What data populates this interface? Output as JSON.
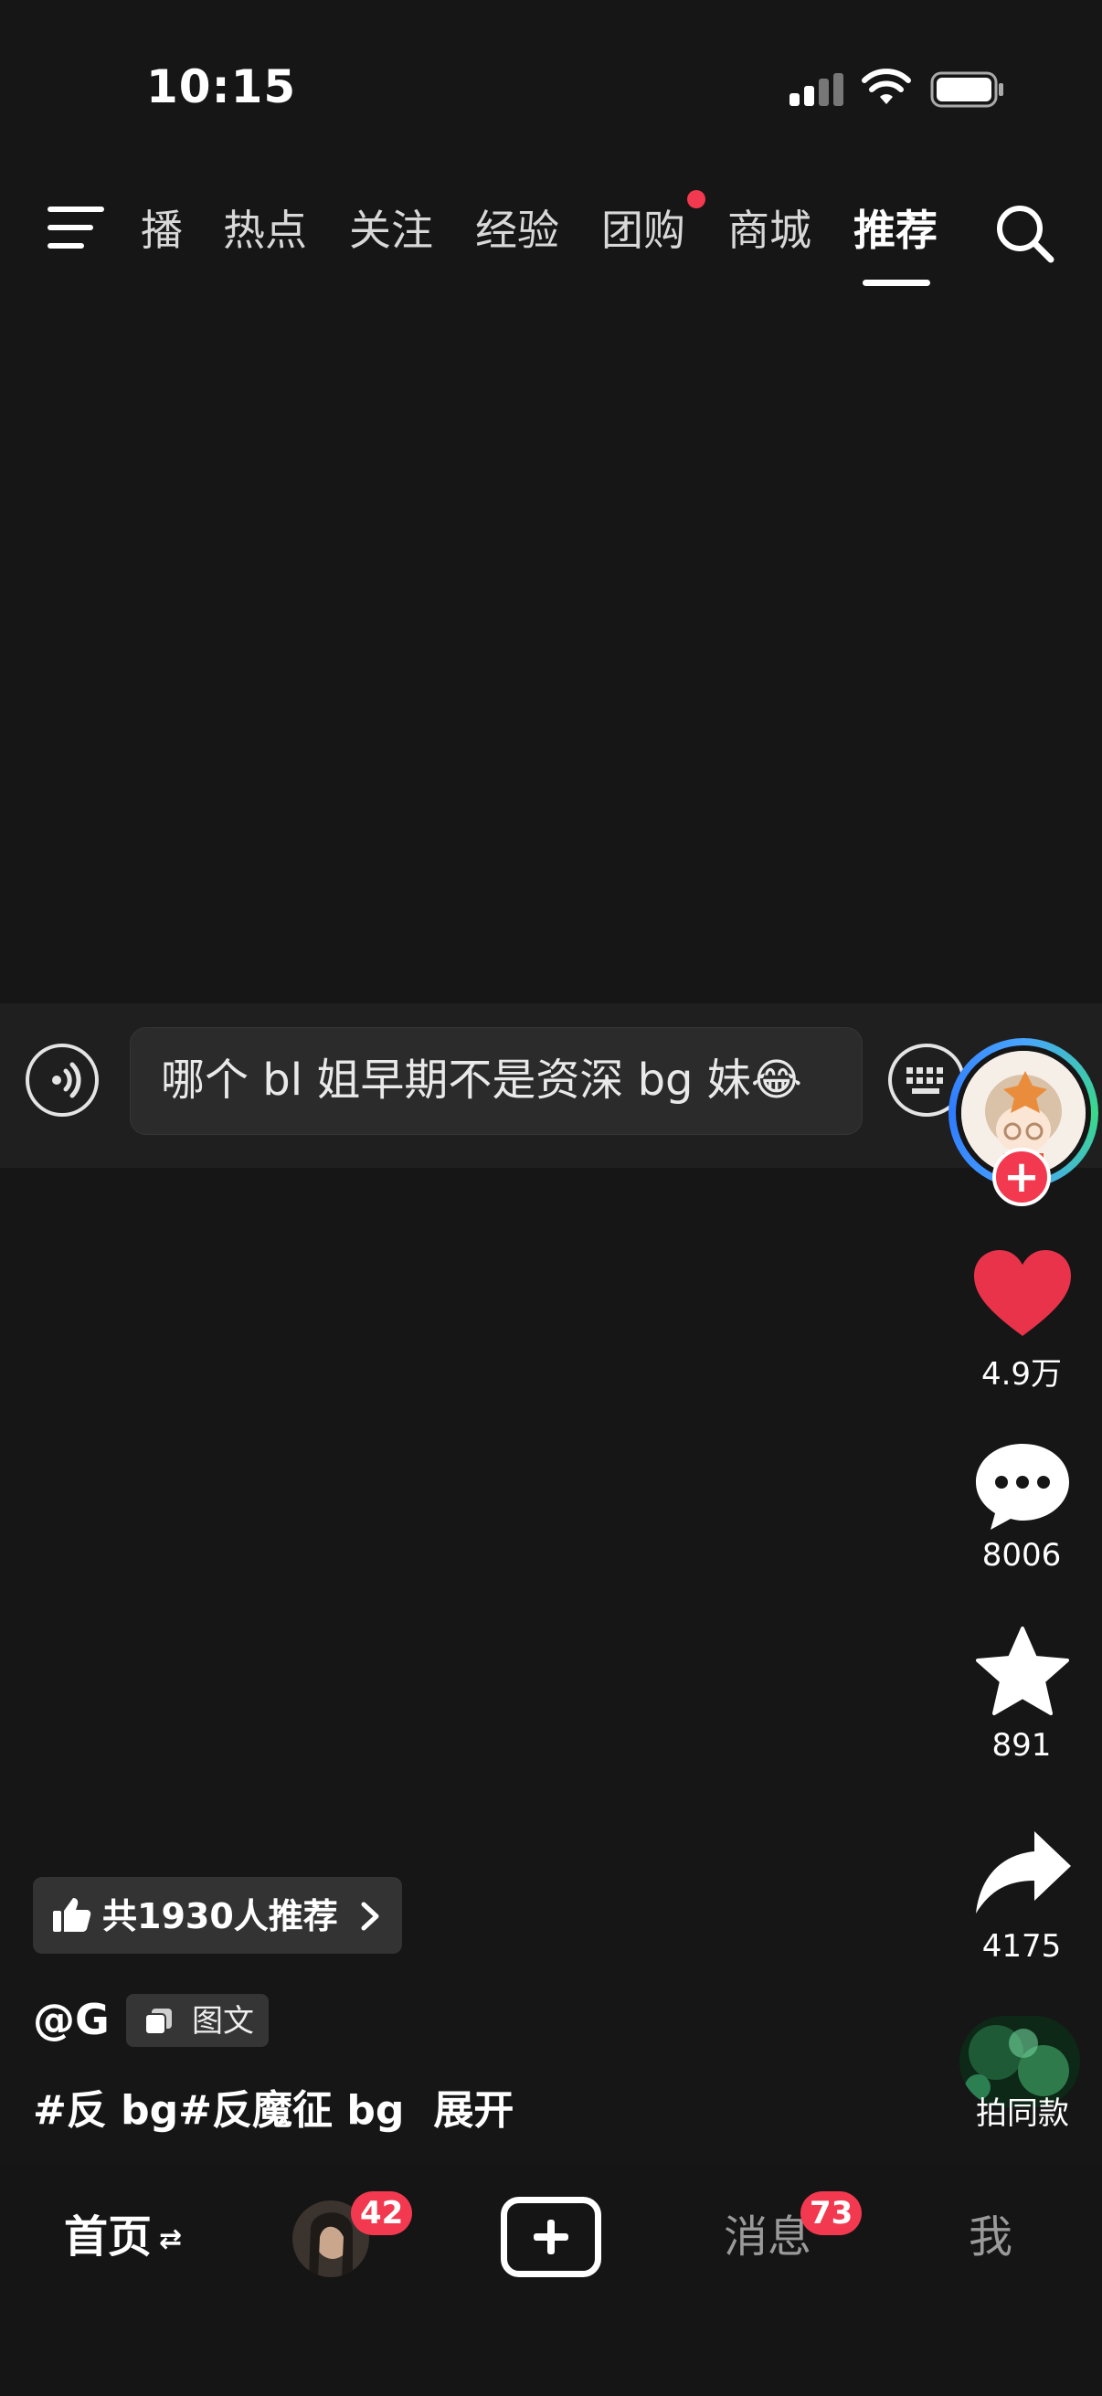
{
  "status_bar": {
    "time": "10:15"
  },
  "nav": {
    "tabs": [
      {
        "label": "播",
        "active": false
      },
      {
        "label": "热点",
        "active": false
      },
      {
        "label": "关注",
        "active": false
      },
      {
        "label": "经验",
        "active": false
      },
      {
        "label": "团购",
        "active": false,
        "has_dot": true
      },
      {
        "label": "商城",
        "active": false
      },
      {
        "label": "推荐",
        "active": true
      }
    ]
  },
  "comment_bar": {
    "text": "哪个 bl 姐早期不是资深 bg 妹😂"
  },
  "rail": {
    "like_count": "4.9万",
    "comment_count": "8006",
    "favorite_count": "891",
    "share_count": "4175"
  },
  "post": {
    "recommend_text": "共1930人推荐",
    "author": "@G",
    "type_badge": "图文",
    "hashtags": "#反 bg#反魔征 bg",
    "expand_label": "展开",
    "music_label": "拍同款"
  },
  "tabbar": {
    "home_label": "首页",
    "home_switch_glyph": "⇄",
    "friends_badge": "42",
    "messages_label": "消息",
    "messages_badge": "73",
    "me_label": "我"
  },
  "colors": {
    "background": "#161616",
    "accent_red": "#f2394f",
    "like_red": "#e8334a"
  }
}
